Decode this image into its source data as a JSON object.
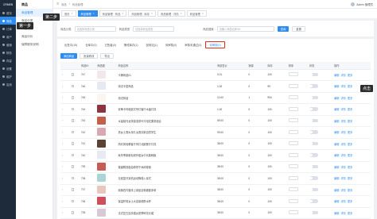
{
  "rail": {
    "brand": "CRMEB",
    "items": [
      {
        "label": "首页",
        "active": false
      },
      {
        "label": "商品",
        "active": true
      },
      {
        "label": "订单",
        "active": false
      },
      {
        "label": "用户",
        "active": false
      },
      {
        "label": "营销",
        "active": false
      },
      {
        "label": "财务",
        "active": false
      },
      {
        "label": "内容",
        "active": false
      },
      {
        "label": "设置",
        "active": false
      },
      {
        "label": "维护",
        "active": false
      },
      {
        "label": "应用",
        "active": false
      }
    ]
  },
  "submenu": {
    "title": "商品",
    "items": [
      {
        "label": "商品管理",
        "active": true
      },
      {
        "label": "商品分类",
        "active": false
      },
      {
        "label": "商品规格",
        "active": false
      },
      {
        "label": "商品评价",
        "active": false
      },
      {
        "label": "保障服务说明",
        "active": false
      }
    ]
  },
  "steps": {
    "step1": "第一步",
    "step2": "第二步",
    "click": "点击"
  },
  "topbar": {
    "crumb1": "商品",
    "crumb2": "商品管理",
    "user": "Admin 管理员"
  },
  "tabs": [
    {
      "label": "首页",
      "active": false
    },
    {
      "label": "商品管理",
      "active": true
    },
    {
      "label": "商品管理 · 商品",
      "active": false
    },
    {
      "label": "商品管理 · 库存",
      "active": false
    },
    {
      "label": "商品管理 · 详情",
      "active": false
    },
    {
      "label": "商品管理",
      "active": false
    }
  ],
  "filters": {
    "category_label": "商品分类",
    "category_placeholder": "请选择商品分类",
    "type_label": "商品类型",
    "type_placeholder": "请选择商品类型",
    "search_label": "商品搜索",
    "search_placeholder": "请输入商品名称/ID",
    "query_button": "查询",
    "reset_button": "重置"
  },
  "status_tabs": [
    {
      "label": "出售中(15)",
      "active": false
    },
    {
      "label": "仓库中(0)",
      "active": false
    },
    {
      "label": "已售罄(0)",
      "active": false
    },
    {
      "label": "警戒库存(1)",
      "active": false
    },
    {
      "label": "回收站(1)",
      "active": false
    },
    {
      "label": "待审核(0)",
      "active": false
    },
    {
      "label": "审核未通过(0)",
      "active": false
    },
    {
      "label": "待审核(0)",
      "active": true
    }
  ],
  "actions": {
    "add": "添加商品",
    "batch": "批量修改",
    "export": "导出"
  },
  "table": {
    "headers": [
      "",
      "",
      "商品ID",
      "商品图",
      "商品名称",
      "商品售价",
      "销量",
      "库存",
      "排序",
      "状态",
      "操作"
    ],
    "rows": [
      {
        "id": "747",
        "name": "卡牌商品01",
        "price": "0.01",
        "sales": "0",
        "stock": "100",
        "color": "#f3e7ec"
      },
      {
        "id": "746",
        "name": "测试卡密商品",
        "price": "1.00",
        "sales": "0",
        "stock": "99",
        "color": "#e6e9f0"
      },
      {
        "id": "745",
        "name": "测试商品",
        "price": "10.00",
        "sales": "1",
        "stock": "994",
        "color": "#fbf7ee"
      },
      {
        "id": "744",
        "name": "安蒂卡玛哈欧式吊灯客厅水晶灯具",
        "price": "1.00",
        "sales": "0",
        "stock": "100",
        "color": "#8a3540"
      },
      {
        "id": "743",
        "name": "水蜜桃乌龙茶袋泡茶叶冷泡花果茶组合",
        "price": "59.00",
        "sales": "0",
        "stock": "100",
        "color": "#c45f4a"
      },
      {
        "id": "742",
        "name": "男女士香水持久淡香清新自然学生",
        "price": "99.00",
        "sales": "0",
        "stock": "100",
        "color": "#d9a8b3"
      },
      {
        "id": "741",
        "name": "简约风轻奢客厅吊灯北欧餐厅灯具",
        "price": "38.00",
        "sales": "0",
        "stock": "100",
        "color": "#5a4236"
      },
      {
        "id": "740",
        "name": "秋冬季新款毛呢外套女中长款韩版",
        "price": "38.00",
        "sales": "0",
        "stock": "100",
        "color": "#e7eaf0"
      },
      {
        "id": "739",
        "name": "蔓越莓燕麦曲奇饼干休闲零食",
        "price": "38.00",
        "sales": "0",
        "stock": "100",
        "color": "#c75c52"
      },
      {
        "id": "738",
        "name": "无线蓝牙耳机运动降噪入耳式",
        "price": "38.00",
        "sales": "0",
        "stock": "100",
        "color": "#a9d5d5"
      },
      {
        "id": "737",
        "name": "纯棉四件套床上用品全棉被套床单",
        "price": "38.00",
        "sales": "0",
        "stock": "100",
        "color": "#e8c7bf"
      },
      {
        "id": "736",
        "name": "保温杯男女士大容量便携水杯",
        "price": "38.00",
        "sales": "0",
        "stock": "100",
        "color": "#cf4e5b"
      },
      {
        "id": "735",
        "name": "法式复古连衣裙女夏季碎花长裙",
        "price": "38.00",
        "sales": "0",
        "stock": "100",
        "color": "#d8c9d4"
      }
    ],
    "op_edit": "编辑",
    "op_detail": "详情",
    "op_more": "更多"
  },
  "colors": {
    "primary": "#2d8cf0",
    "rail_bg": "#1d2b3a",
    "highlight": "#e0301e"
  }
}
